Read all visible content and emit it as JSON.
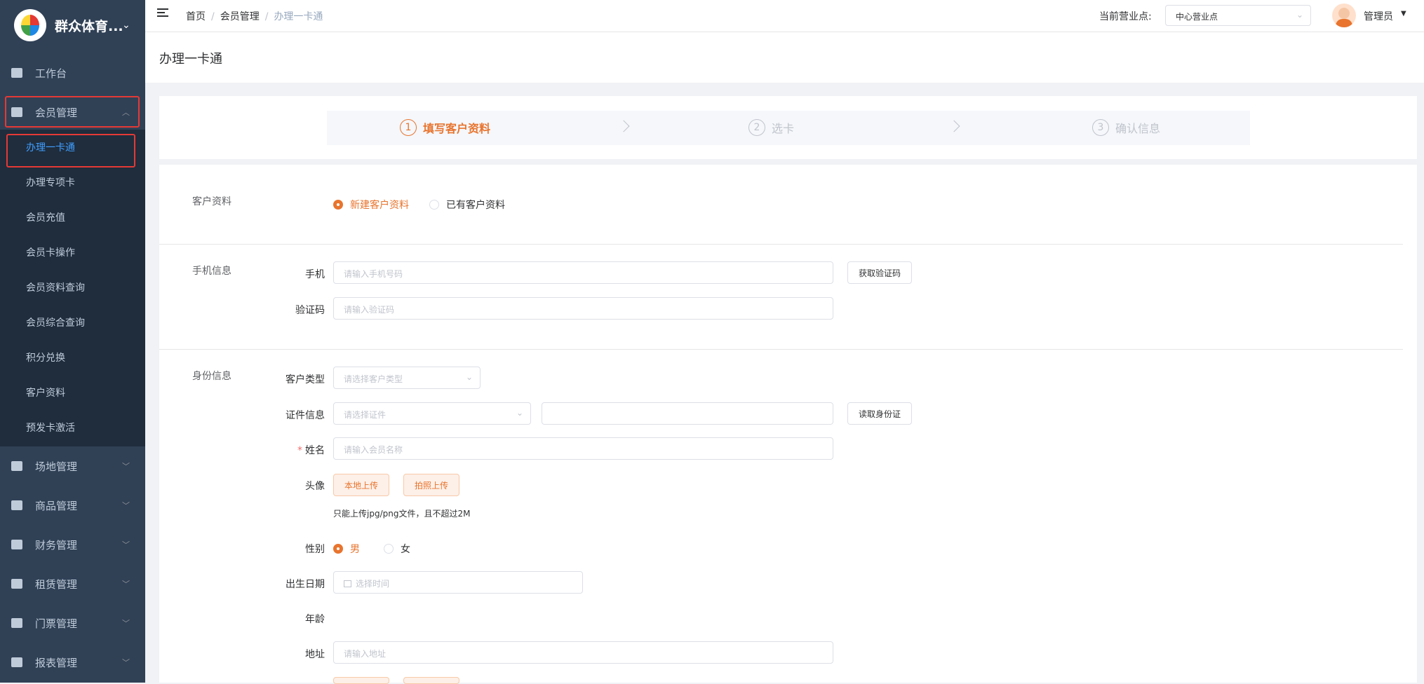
{
  "app": {
    "title": "群众体育..."
  },
  "sidebar": {
    "menu": [
      {
        "label": "工作台",
        "icon": "dashboard-icon"
      },
      {
        "label": "会员管理",
        "icon": "member-icon"
      },
      {
        "label": "场地管理",
        "icon": "venue-icon"
      },
      {
        "label": "商品管理",
        "icon": "goods-icon"
      },
      {
        "label": "财务管理",
        "icon": "finance-icon"
      },
      {
        "label": "租赁管理",
        "icon": "lease-icon"
      },
      {
        "label": "门票管理",
        "icon": "ticket-icon"
      },
      {
        "label": "报表管理",
        "icon": "report-icon"
      }
    ],
    "submenu": [
      {
        "label": "办理一卡通"
      },
      {
        "label": "办理专项卡"
      },
      {
        "label": "会员充值"
      },
      {
        "label": "会员卡操作"
      },
      {
        "label": "会员资料查询"
      },
      {
        "label": "会员综合查询"
      },
      {
        "label": "积分兑换"
      },
      {
        "label": "客户资料"
      },
      {
        "label": "预发卡激活"
      }
    ]
  },
  "header": {
    "breadcrumb": [
      "首页",
      "会员管理",
      "办理一卡通"
    ],
    "sep": "/",
    "outlet_label": "当前营业点:",
    "outlet_value": "中心营业点",
    "user": "管理员"
  },
  "page": {
    "title": "办理一卡通"
  },
  "steps": [
    {
      "num": "1",
      "label": "填写客户资料"
    },
    {
      "num": "2",
      "label": "选卡"
    },
    {
      "num": "3",
      "label": "确认信息"
    }
  ],
  "form": {
    "customer_section": "客户资料",
    "radio_new": "新建客户资料",
    "radio_existing": "已有客户资料",
    "phone_section": "手机信息",
    "phone_label": "手机",
    "phone_placeholder": "请输入手机号码",
    "get_code_btn": "获取验证码",
    "code_label": "验证码",
    "code_placeholder": "请输入验证码",
    "identity_section": "身份信息",
    "cust_type_label": "客户类型",
    "cust_type_placeholder": "请选择客户类型",
    "cert_label": "证件信息",
    "cert_placeholder": "请选择证件",
    "read_id_btn": "读取身份证",
    "name_label": "姓名",
    "name_required": "*",
    "name_placeholder": "请输入会员名称",
    "avatar_label": "头像",
    "local_upload_btn": "本地上传",
    "photo_upload_btn": "拍照上传",
    "upload_hint": "只能上传jpg/png文件，且不超过2M",
    "gender_label": "性别",
    "male": "男",
    "female": "女",
    "birth_label": "出生日期",
    "birth_placeholder": "选择时间",
    "age_label": "年龄",
    "address_label": "地址",
    "address_placeholder": "请输入地址"
  },
  "colors": {
    "accent": "#e8742e",
    "sidebar": "#304156",
    "submenu": "#1f2d3d",
    "active_link": "#409eff",
    "highlight_box": "#e53935"
  }
}
